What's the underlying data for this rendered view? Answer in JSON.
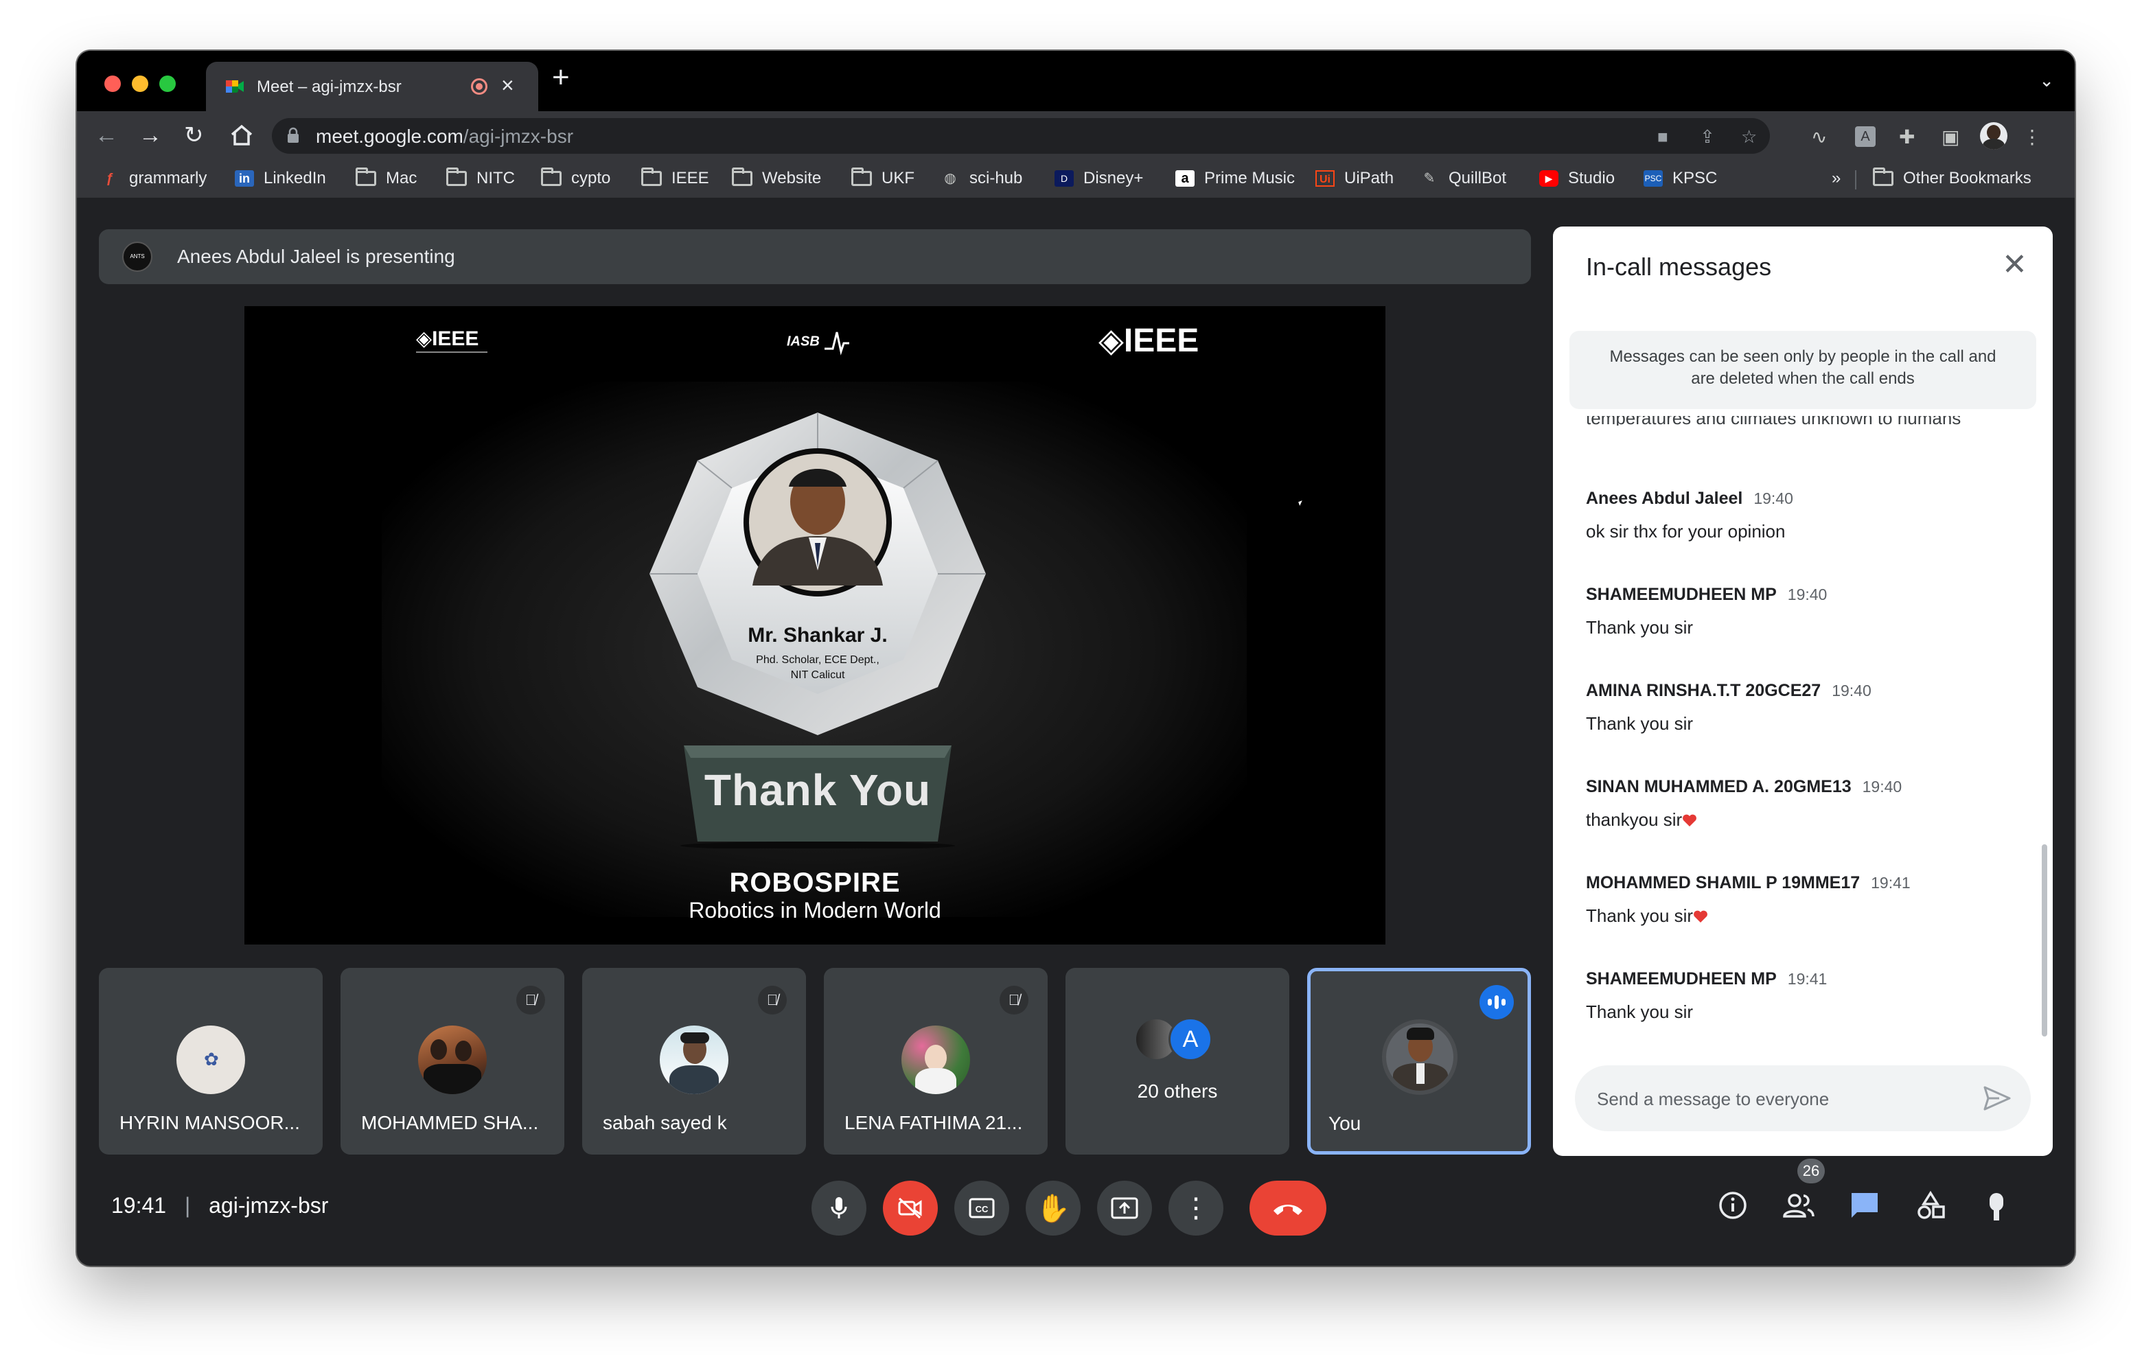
{
  "browser": {
    "tab_title": "Meet – agi-jmzx-bsr",
    "tab_close": "×",
    "new_tab": "+",
    "tab_menu": "⌄",
    "url_domain": "meet.google.com",
    "url_path": "/agi-jmzx-bsr",
    "bookmarks": [
      "grammarly",
      "LinkedIn",
      "Mac",
      "NITC",
      "cypto",
      "IEEE",
      "Website",
      "UKF",
      "sci-hub",
      "Disney+",
      "Prime Music",
      "UiPath",
      "QuillBot",
      "Studio",
      "KPSC"
    ],
    "bookmarks_overflow": "»",
    "other_bookmarks": "Other Bookmarks"
  },
  "presentation": {
    "banner": "Anees Abdul Jaleel is presenting",
    "presenter_avatar_text": "ANTS",
    "slide": {
      "logo_left": "◈IEEE",
      "logo_right": "◈IEEE",
      "logo_center": "IASB",
      "person_name": "Mr. Shankar J.",
      "person_line1": "Phd. Scholar, ECE Dept.,",
      "person_line2": "NIT Calicut",
      "thank_you": "Thank You",
      "event": "ROBOSPIRE",
      "event_sub": "Robotics in Modern World"
    }
  },
  "participants": [
    {
      "name": "HYRIN MANSOOR...",
      "muted": false
    },
    {
      "name": "MOHAMMED SHA...",
      "muted": true
    },
    {
      "name": "sabah sayed k",
      "muted": true
    },
    {
      "name": "LENA FATHIMA 21...",
      "muted": true
    },
    {
      "name": "20 others",
      "avatar_letter": "A"
    },
    {
      "name": "You",
      "speaking": true
    }
  ],
  "bottom": {
    "time": "19:41",
    "separator": "|",
    "meeting_code": "agi-jmzx-bsr",
    "people_count": "26"
  },
  "chat": {
    "title": "In-call messages",
    "notice": "Messages can be seen only by people in the call and are deleted when the call ends",
    "cut_off_text": "temperatures and climates unknown to humans",
    "messages": [
      {
        "sender": "Anees Abdul Jaleel",
        "time": "19:40",
        "text": "ok sir thx for your opinion"
      },
      {
        "sender": "SHAMEEMUDHEEN MP",
        "time": "19:40",
        "text": "Thank you sir"
      },
      {
        "sender": "AMINA RINSHA.T.T 20GCE27",
        "time": "19:40",
        "text": "Thank you sir"
      },
      {
        "sender": "SINAN MUHAMMED A. 20GME13",
        "time": "19:40",
        "text": "thankyou sir"
      },
      {
        "sender": "MOHAMMED SHAMIL P 19MME17",
        "time": "19:41",
        "text": "Thank you sir"
      },
      {
        "sender": "SHAMEEMUDHEEN MP",
        "time": "19:41",
        "text": "Thank you sir"
      }
    ],
    "input_placeholder": "Send a message to everyone"
  },
  "colors": {
    "meet_bg": "#202124",
    "tile_bg": "#3c4043",
    "hangup_red": "#ea4335",
    "accent_blue": "#1a73e8",
    "speaking_border": "#8ab4f8"
  }
}
